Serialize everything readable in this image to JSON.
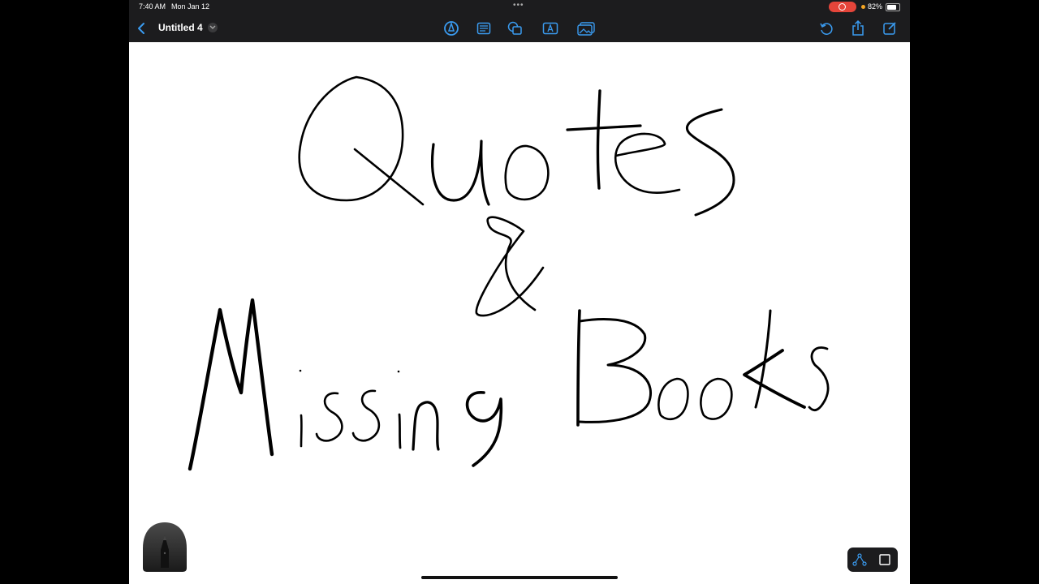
{
  "status_bar": {
    "time": "7:40 AM",
    "date": "Mon Jan 12",
    "battery_percent": "82%",
    "battery_level": 0.82
  },
  "toolbar": {
    "doc_title": "Untitled 4",
    "icons": [
      "back-icon",
      "pen-tool-icon",
      "text-box-icon",
      "shapes-icon",
      "text-icon",
      "image-icon",
      "undo-icon",
      "share-icon",
      "compose-icon"
    ]
  },
  "canvas": {
    "handwriting": [
      "Quotes",
      "&",
      "Missing Books"
    ]
  },
  "colors": {
    "accent": "#3a9bf0",
    "record": "#e5453a",
    "ink": "#000000",
    "background": "#1c1c1e"
  }
}
